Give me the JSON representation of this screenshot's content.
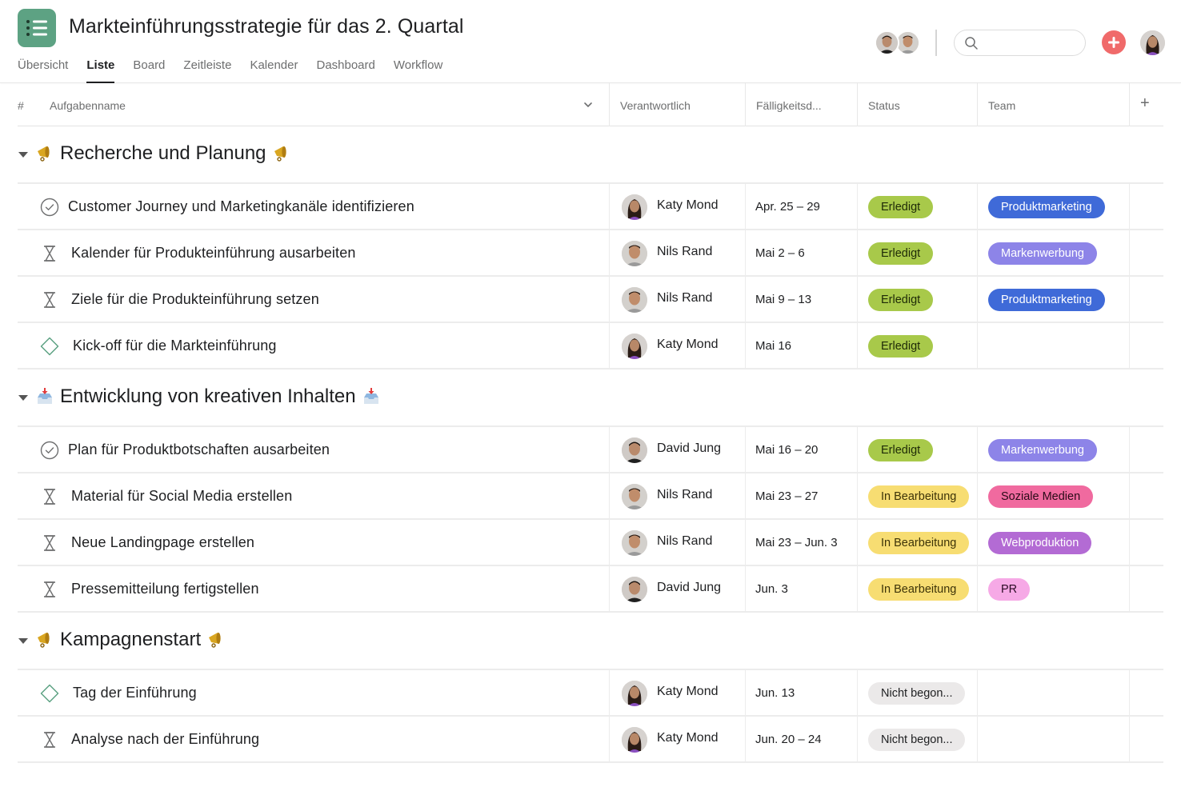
{
  "project": {
    "title": "Markteinführungsstrategie für das 2. Quartal",
    "icon": "list-icon",
    "icon_color": "#5da283"
  },
  "tabs": [
    {
      "label": "Übersicht",
      "active": false
    },
    {
      "label": "Liste",
      "active": true
    },
    {
      "label": "Board",
      "active": false
    },
    {
      "label": "Zeitleiste",
      "active": false
    },
    {
      "label": "Kalender",
      "active": false
    },
    {
      "label": "Dashboard",
      "active": false
    },
    {
      "label": "Workflow",
      "active": false
    }
  ],
  "header_right": {
    "members": [
      "David Jung",
      "Nils Rand"
    ],
    "search": {
      "placeholder": "",
      "value": ""
    },
    "add_button_icon": "plus-icon",
    "add_button_color": "#f06a6a",
    "current_user": "Katy Mond"
  },
  "columns": {
    "hash": "#",
    "name": "Aufgabenname",
    "owner": "Verantwortlich",
    "due": "Fälligkeitsd...",
    "status": "Status",
    "team": "Team",
    "add": "+"
  },
  "status_colors": {
    "Erledigt": {
      "bg": "#a8c94a",
      "fg": "#1e2a07"
    },
    "In Bearbeitung": {
      "bg": "#f7dd72",
      "fg": "#3d3308"
    },
    "Nicht begon...": {
      "bg": "#ebe9e9",
      "fg": "#1e1f21"
    }
  },
  "team_colors": {
    "Produktmarketing": {
      "bg": "#3f6ad8",
      "fg": "#ffffff"
    },
    "Markenwerbung": {
      "bg": "#8d84e8",
      "fg": "#ffffff"
    },
    "Soziale Medien": {
      "bg": "#f06a9f",
      "fg": "#2a0b18"
    },
    "Webproduktion": {
      "bg": "#b36bd4",
      "fg": "#ffffff"
    },
    "PR": {
      "bg": "#f6a9e6",
      "fg": "#2a0b25"
    }
  },
  "sections": [
    {
      "title": "Recherche und Planung",
      "emoji": "megaphone",
      "tasks": [
        {
          "name": "Customer Journey und Marketingkanäle identifizieren",
          "icon": "check-circle",
          "owner": "Katy Mond",
          "due": "Apr. 25 – 29",
          "status": "Erledigt",
          "team": "Produktmarketing"
        },
        {
          "name": "Kalender für Produkteinführung ausarbeiten",
          "icon": "hourglass",
          "owner": "Nils Rand",
          "due": "Mai 2 – 6",
          "status": "Erledigt",
          "team": "Markenwerbung"
        },
        {
          "name": "Ziele für die Produkteinführung setzen",
          "icon": "hourglass",
          "owner": "Nils Rand",
          "due": "Mai 9 – 13",
          "status": "Erledigt",
          "team": "Produktmarketing"
        },
        {
          "name": "Kick-off für die Markteinführung",
          "icon": "milestone-diamond",
          "owner": "Katy Mond",
          "due": "Mai 16",
          "status": "Erledigt",
          "team": ""
        }
      ]
    },
    {
      "title": "Entwicklung von kreativen Inhalten",
      "emoji": "inbox-tray",
      "tasks": [
        {
          "name": "Plan für Produktbotschaften ausarbeiten",
          "icon": "check-circle",
          "owner": "David Jung",
          "due": "Mai 16 – 20",
          "status": "Erledigt",
          "team": "Markenwerbung"
        },
        {
          "name": "Material für Social Media erstellen",
          "icon": "hourglass",
          "owner": "Nils Rand",
          "due": "Mai 23 – 27",
          "status": "In Bearbeitung",
          "team": "Soziale Medien"
        },
        {
          "name": "Neue Landingpage erstellen",
          "icon": "hourglass",
          "owner": "Nils Rand",
          "due": "Mai 23 – Jun. 3",
          "status": "In Bearbeitung",
          "team": "Webproduktion"
        },
        {
          "name": "Pressemitteilung fertigstellen",
          "icon": "hourglass",
          "owner": "David Jung",
          "due": "Jun. 3",
          "status": "In Bearbeitung",
          "team": "PR"
        }
      ]
    },
    {
      "title": "Kampagnenstart",
      "emoji": "megaphone",
      "tasks": [
        {
          "name": "Tag der Einführung",
          "icon": "milestone-diamond",
          "owner": "Katy Mond",
          "due": "Jun. 13",
          "status": "Nicht begon...",
          "team": ""
        },
        {
          "name": "Analyse nach der Einführung",
          "icon": "hourglass",
          "owner": "Katy Mond",
          "due": "Jun. 20 – 24",
          "status": "Nicht begon...",
          "team": ""
        }
      ]
    }
  ]
}
